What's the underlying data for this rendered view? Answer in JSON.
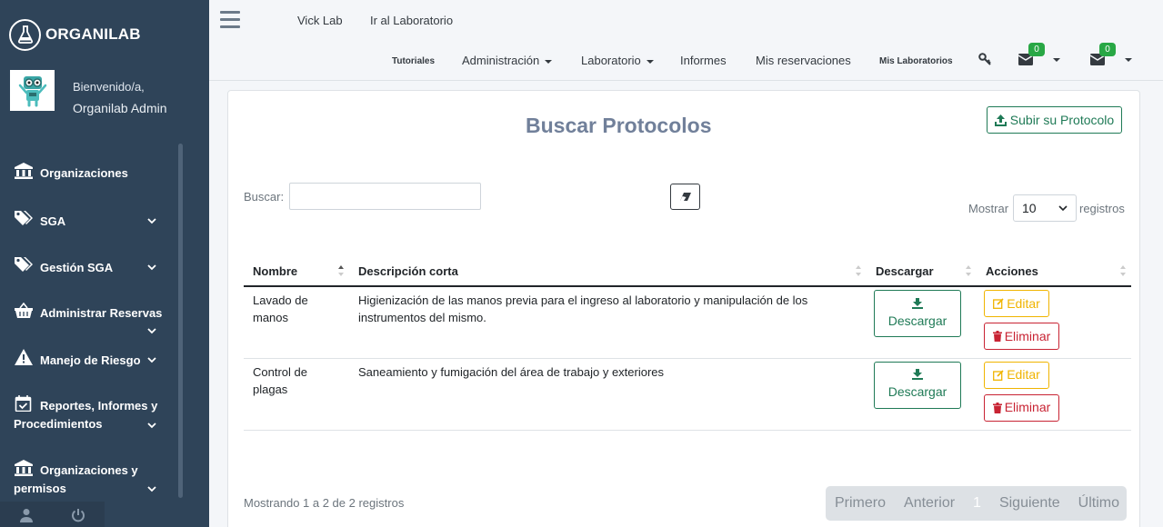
{
  "brand": {
    "name": "ORGANILAB"
  },
  "user": {
    "greeting": "Bienvenido/a,",
    "name": "Organilab Admin"
  },
  "sidebar": {
    "items": [
      {
        "label": "Organizaciones",
        "icon": "bank-icon",
        "expandable": false
      },
      {
        "label": "SGA",
        "icon": "tags-icon",
        "expandable": true
      },
      {
        "label": "Gestión SGA",
        "icon": "tags-icon",
        "expandable": true
      },
      {
        "label": "Administrar Reservas",
        "icon": "basket-icon",
        "expandable": true
      },
      {
        "label": "Manejo de Riesgo",
        "icon": "warning-icon",
        "expandable": true
      },
      {
        "label": "Reportes, Informes y Procedimientos",
        "icon": "calendar-check-icon",
        "expandable": true
      },
      {
        "label": "Organizaciones y permisos",
        "icon": "bank-icon",
        "expandable": true
      }
    ]
  },
  "topbar": {
    "links": [
      "Vick Lab",
      "Ir al Laboratorio"
    ],
    "menu": {
      "tutoriales": "Tutoriales",
      "administracion": "Administración",
      "laboratorio": "Laboratorio",
      "informes": "Informes",
      "reservaciones": "Mis reservaciones",
      "mis_laboratorios": "Mis Laboratorios"
    },
    "badges": [
      "0",
      "0"
    ]
  },
  "page": {
    "title": "Buscar Protocolos",
    "upload_label": "Subir su Protocolo",
    "search_label": "Buscar:",
    "search_value": "",
    "show_label": "Mostrar",
    "show_value": "10",
    "records_label": "registros"
  },
  "table": {
    "headers": [
      "Nombre",
      "Descripción corta",
      "Descargar",
      "Acciones"
    ],
    "download_label": "Descargar",
    "edit_label": "Editar",
    "delete_label": "Eliminar",
    "rows": [
      {
        "name": "Lavado de manos",
        "description": "Higienización de las manos previa para el ingreso al laboratorio y manipulación de los instrumentos del mismo."
      },
      {
        "name": "Control de plagas",
        "description": "Saneamiento y fumigación del área de trabajo y exteriores"
      }
    ]
  },
  "footer": {
    "info": "Mostrando 1 a 2 de 2 registros",
    "pagination": {
      "first": "Primero",
      "prev": "Anterior",
      "current": "1",
      "next": "Siguiente",
      "last": "Último"
    }
  },
  "colors": {
    "sidebar": "#2f4459",
    "success": "#1f7a56",
    "warning": "#f0b400",
    "danger": "#c82333",
    "title": "#71809a"
  }
}
